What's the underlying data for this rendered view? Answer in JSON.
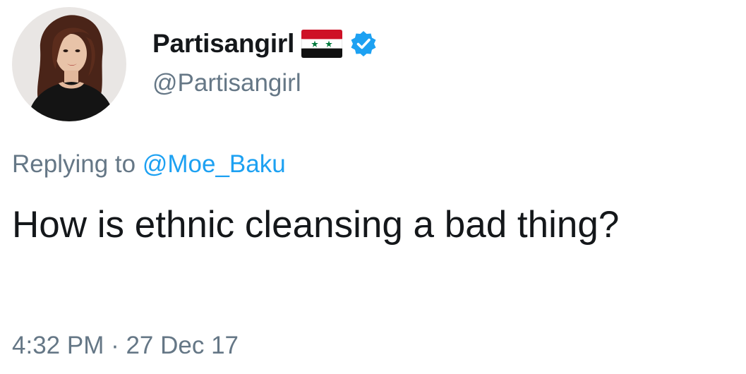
{
  "author": {
    "display_name": "Partisangirl",
    "handle": "@Partisangirl",
    "flag_icon": "syria-flag-icon",
    "verified_icon": "verified-badge-icon",
    "verified_color": "#1da1f2"
  },
  "reply": {
    "prefix": "Replying to",
    "mention": "@Moe_Baku"
  },
  "tweet": {
    "text": "How is ethnic cleansing a bad thing?",
    "timestamp": "4:32 PM · 27 Dec 17"
  },
  "colors": {
    "text_primary": "#14171a",
    "text_secondary": "#657786",
    "link": "#1da1f2"
  }
}
